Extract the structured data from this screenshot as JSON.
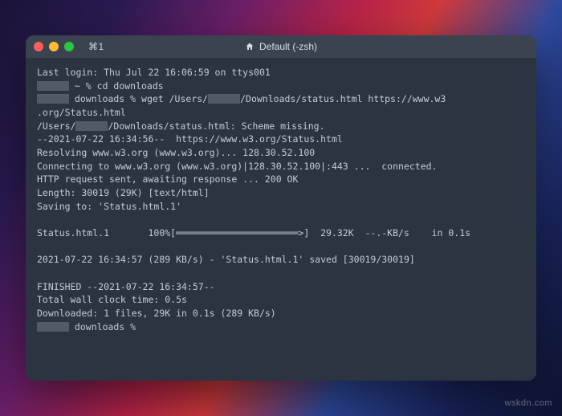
{
  "titlebar": {
    "tab_indicator": "⌘1",
    "title_prefix_icon": "home",
    "title": "Default (-zsh)"
  },
  "terminal": {
    "last_login": "Last login: Thu Jul 22 16:06:59 on ttys001",
    "cmd1_prompt": " ~ % ",
    "cmd1": "cd downloads",
    "cmd2_prompt": " downloads % ",
    "cmd2_a": "wget /Users/",
    "cmd2_b": "/Downloads/status.html https://www.w3",
    "cmd2_c": ".org/Status.html",
    "out_scheme_a": "/Users/",
    "out_scheme_b": "/Downloads/status.html: Scheme missing.",
    "out_start": "--2021-07-22 16:34:56--  https://www.w3.org/Status.html",
    "out_resolve": "Resolving www.w3.org (www.w3.org)... 128.30.52.100",
    "out_connect": "Connecting to www.w3.org (www.w3.org)|128.30.52.100|:443 ...  connected.",
    "out_req": "HTTP request sent, awaiting response ... 200 OK",
    "out_len": "Length: 30019 (29K) [text/html]",
    "out_saving": "Saving to: 'Status.html.1'",
    "out_progress": "Status.html.1       100%[══════════════════════>]  29.32K  --.-KB/s    in 0.1s",
    "out_saved": "2021-07-22 16:34:57 (289 KB/s) - 'Status.html.1' saved [30019/30019]",
    "out_finished": "FINISHED --2021-07-22 16:34:57--",
    "out_wall": "Total wall clock time: 0.5s",
    "out_dl": "Downloaded: 1 files, 29K in 0.1s (289 KB/s)",
    "cmd3_prompt": " downloads % ",
    "redact": "      "
  },
  "watermark": "wskdn.com"
}
